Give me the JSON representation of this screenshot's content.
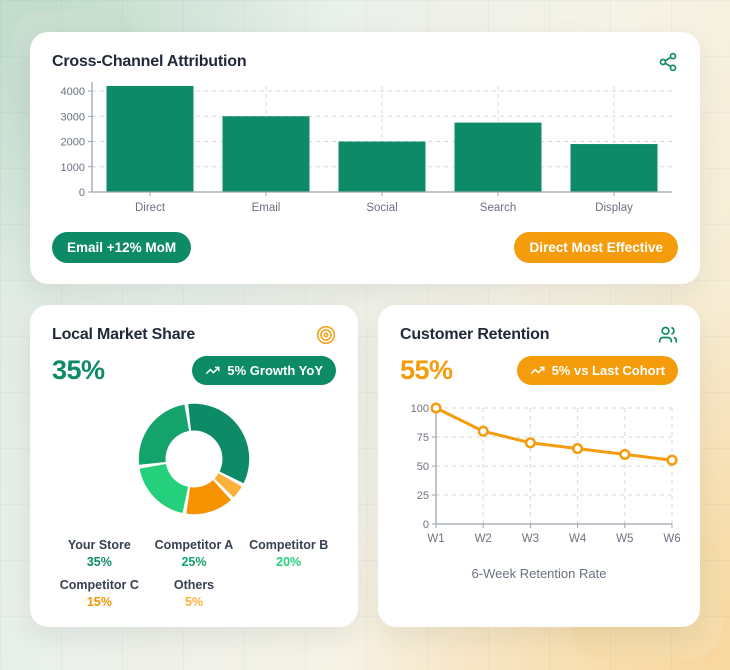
{
  "colors": {
    "green": "#0d8a66",
    "green_mid": "#15a36c",
    "green_light": "#25d07d",
    "orange": "#f59c0c",
    "orange_deep": "#f59300",
    "amber": "#f9b13a",
    "axis_gray": "#9ca3af",
    "grid_gray": "#d5d9de",
    "text_dark": "#1f2937",
    "text_gray": "#6b7280"
  },
  "cards": {
    "attribution": {
      "title": "Cross-Channel Attribution",
      "icon": "share-icon",
      "badges": {
        "left": "Email +12% MoM",
        "right": "Direct Most Effective"
      }
    },
    "market_share": {
      "title": "Local Market Share",
      "icon": "target-icon",
      "metric": "35%",
      "badge": "5% Growth YoY"
    },
    "retention": {
      "title": "Customer Retention",
      "icon": "users-icon",
      "metric": "55%",
      "badge": "5% vs Last Cohort",
      "caption": "6-Week Retention Rate"
    }
  },
  "chart_data": [
    {
      "type": "bar",
      "title": "Cross-Channel Attribution",
      "categories": [
        "Direct",
        "Email",
        "Social",
        "Search",
        "Display"
      ],
      "values": [
        4200,
        3000,
        2000,
        2750,
        1900
      ],
      "yticks": [
        0,
        1000,
        2000,
        3000,
        4000
      ],
      "ylim": [
        0,
        4200
      ],
      "bar_color": "#0d8a66",
      "grid": true,
      "legend_position": "none",
      "xlabel": "",
      "ylabel": ""
    },
    {
      "type": "pie",
      "donut": true,
      "title": "Local Market Share",
      "segments": [
        {
          "label": "Your Store",
          "value": 35,
          "value_label": "35%",
          "color": "#0d8a66"
        },
        {
          "label": "Competitor A",
          "value": 25,
          "value_label": "25%",
          "color": "#15a36c"
        },
        {
          "label": "Competitor B",
          "value": 20,
          "value_label": "20%",
          "color": "#25d07d"
        },
        {
          "label": "Competitor C",
          "value": 15,
          "value_label": "15%",
          "color": "#f59300"
        },
        {
          "label": "Others",
          "value": 5,
          "value_label": "5%",
          "color": "#f9b13a"
        }
      ],
      "clockwise_order": [
        0,
        4,
        3,
        2,
        1
      ],
      "start_angle_deg": -8,
      "pad_angle_deg": 4,
      "legend_position": "bottom"
    },
    {
      "type": "line",
      "title": "6-Week Retention Rate",
      "x": [
        "W1",
        "W2",
        "W3",
        "W4",
        "W5",
        "W6"
      ],
      "values": [
        100,
        80,
        70,
        65,
        60,
        55
      ],
      "yticks": [
        0,
        25,
        50,
        75,
        100
      ],
      "ylim": [
        0,
        100
      ],
      "line_color": "#f59c0c",
      "marker": "open-circle",
      "grid": true,
      "legend_position": "none"
    }
  ]
}
